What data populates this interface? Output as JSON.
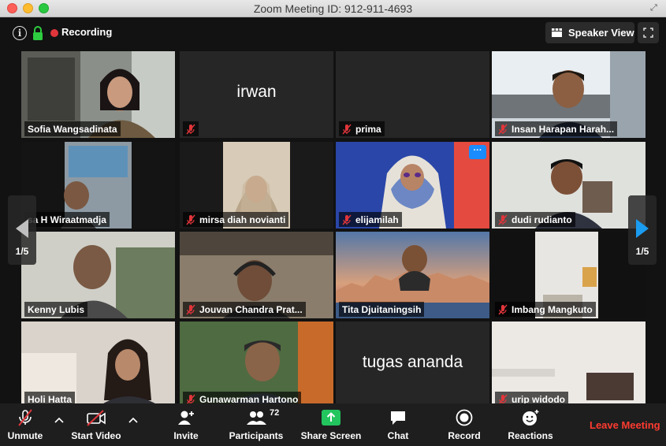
{
  "window": {
    "title": "Zoom Meeting ID: 912-911-4693"
  },
  "topbar": {
    "recording_label": "Recording",
    "speaker_view_label": "Speaker View"
  },
  "gallery": {
    "participants": [
      {
        "name": "Sofia Wangsadinata",
        "muted": false,
        "video": true,
        "active": true
      },
      {
        "name": "irwan",
        "muted": true,
        "video": false,
        "display_name": "irwan"
      },
      {
        "name": "prima",
        "muted": true,
        "video": false
      },
      {
        "name": "Insan Harapan Harah...",
        "muted": true,
        "video": true
      },
      {
        "name": "sa H Wiraatmadja",
        "muted": false,
        "video": true
      },
      {
        "name": "mirsa diah novianti",
        "muted": true,
        "video": true
      },
      {
        "name": "elijamilah",
        "muted": true,
        "video": true
      },
      {
        "name": "dudi rudianto",
        "muted": true,
        "video": true
      },
      {
        "name": "Kenny Lubis",
        "muted": false,
        "video": true
      },
      {
        "name": "Jouvan Chandra Prat...",
        "muted": true,
        "video": true
      },
      {
        "name": "Tita Djuitaningsih",
        "muted": false,
        "video": true
      },
      {
        "name": "Imbang Mangkuto",
        "muted": true,
        "video": true
      },
      {
        "name": "Holi Hatta",
        "muted": false,
        "video": true
      },
      {
        "name": "Gunawarman Hartono",
        "muted": true,
        "video": true
      },
      {
        "name": "tugas ananda",
        "muted": false,
        "video": false,
        "display_name": "tugas ananda"
      },
      {
        "name": "urip widodo",
        "muted": true,
        "video": true
      }
    ],
    "page_left": "1/5",
    "page_right": "1/5"
  },
  "toolbar": {
    "unmute": "Unmute",
    "start_video": "Start Video",
    "invite": "Invite",
    "participants": "Participants",
    "participants_count": "72",
    "share_screen": "Share Screen",
    "chat": "Chat",
    "record": "Record",
    "reactions": "Reactions",
    "leave": "Leave Meeting"
  },
  "colors": {
    "active_speaker": "#c9f07a",
    "share_green": "#22c55e",
    "leave_red": "#ff3b30",
    "recording_red": "#e0353b"
  }
}
